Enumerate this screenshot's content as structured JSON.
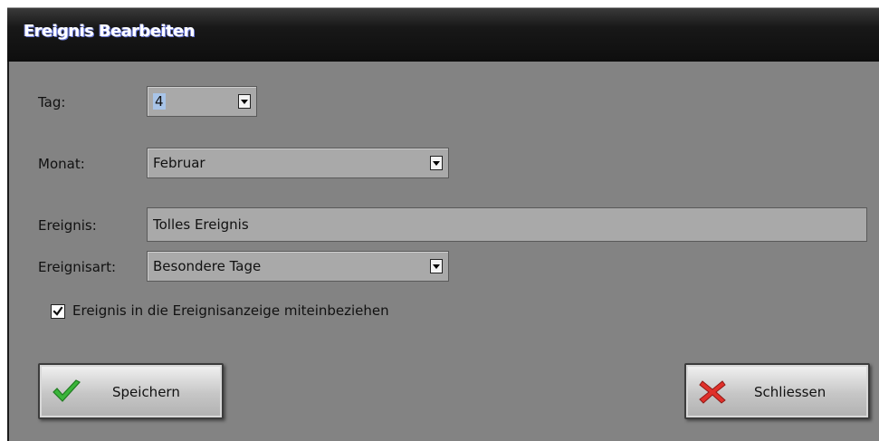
{
  "window": {
    "title": "Ereignis Bearbeiten"
  },
  "form": {
    "tag": {
      "label": "Tag:",
      "value": "4"
    },
    "monat": {
      "label": "Monat:",
      "value": "Februar"
    },
    "ereignis": {
      "label": "Ereignis:",
      "value": "Tolles Ereignis"
    },
    "ereignisart": {
      "label": "Ereignisart:",
      "value": "Besondere Tage"
    },
    "include_checkbox": {
      "label": "Ereignis in die Ereignisanzeige miteinbeziehen",
      "checked": true
    }
  },
  "buttons": {
    "save": {
      "label": "Speichern",
      "icon": "checkmark-icon",
      "color": "#3bb53b"
    },
    "close": {
      "label": "Schliessen",
      "icon": "x-icon",
      "color": "#e0302a"
    }
  }
}
